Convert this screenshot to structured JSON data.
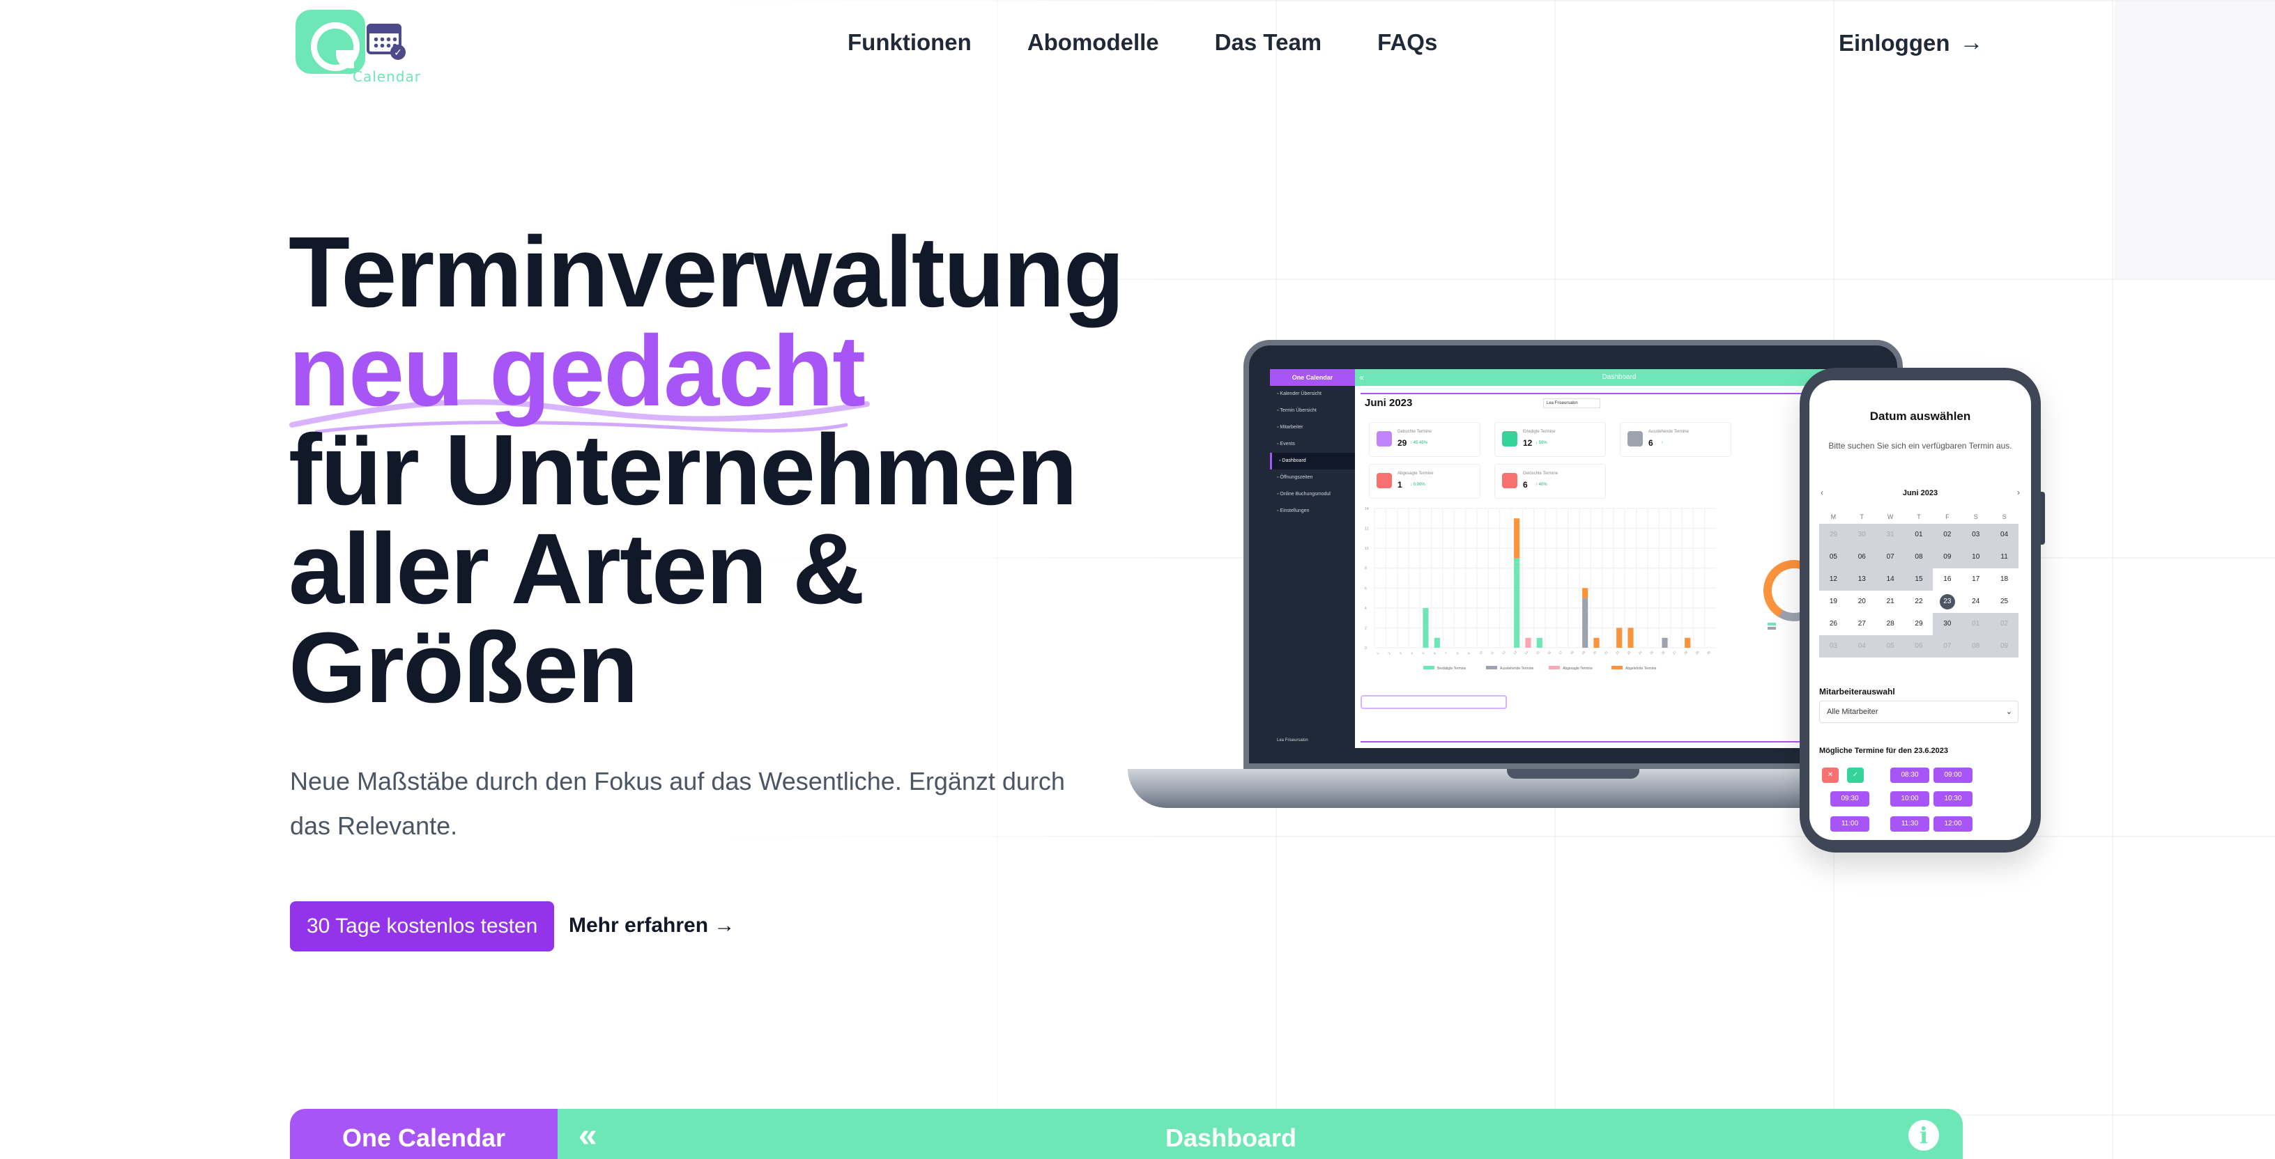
{
  "logo": {
    "alt": "One Calendar Logo",
    "text": "Calendar"
  },
  "nav": {
    "links": [
      "Funktionen",
      "Abomodelle",
      "Das Team",
      "FAQs"
    ],
    "login": "Einloggen",
    "login_arrow": "→"
  },
  "hero": {
    "title_line1": "Terminverwaltung",
    "title_accent": "neu gedacht",
    "title_line3": "für Unternehmen",
    "title_line4": "aller Arten &",
    "title_line5": "Größen",
    "subtitle": "Neue Maßstäbe durch den Fokus auf das Wesentliche. Ergänzt durch das Relevante.",
    "cta": "30 Tage kostenlos testen",
    "more": "Mehr erfahren →"
  },
  "laptop": {
    "brand": "One Calendar",
    "topbar_title": "Dashboard",
    "sidebar": [
      "Kalender Übersicht",
      "Termin Übersicht",
      "Mitarbeiter",
      "Events",
      "Dashboard",
      "Öffnungszeiten",
      "Online Buchungsmodul",
      "Einstellungen"
    ],
    "active_index": 4,
    "user": "Lea Friseursalon",
    "month": "Juni 2023",
    "dropdown": "Lea Friseursalon",
    "stats": [
      {
        "label": "Gebuchte Termine",
        "value": "29",
        "change": "↑ 45.45%",
        "color": "#c084fc"
      },
      {
        "label": "Erledigte Termine",
        "value": "12",
        "change": "↓ 50%",
        "color": "#34d399"
      },
      {
        "label": "Ausstehende Termine",
        "value": "6",
        "change": "↑",
        "color": "#9ca3af"
      },
      {
        "label": "Abgesagte Termine",
        "value": "1",
        "change": "↓ 0.00%",
        "color": "#f87171"
      },
      {
        "label": "Gelöschte Termine",
        "value": "6",
        "change": "↑ 40%",
        "color": "#f87171"
      }
    ]
  },
  "chart_data": {
    "type": "bar",
    "stacked": true,
    "categories": [
      "1",
      "2",
      "3",
      "4",
      "5",
      "6",
      "7",
      "8",
      "9",
      "10",
      "11",
      "12",
      "13",
      "14",
      "15",
      "16",
      "17",
      "18",
      "19",
      "20",
      "21",
      "22",
      "23",
      "24",
      "25",
      "26",
      "27",
      "28",
      "29",
      "30"
    ],
    "series": [
      {
        "name": "Bestätigte Termine",
        "color": "#6ee7b7",
        "values": [
          0,
          0,
          0,
          0,
          4,
          1,
          0,
          0,
          0,
          0,
          0,
          0,
          9,
          0,
          1,
          0,
          0,
          0,
          0,
          0,
          0,
          0,
          0,
          0,
          0,
          0,
          0,
          0,
          0,
          0
        ]
      },
      {
        "name": "Ausstehende Termine",
        "color": "#9ca3af",
        "values": [
          0,
          0,
          0,
          0,
          0,
          0,
          0,
          0,
          0,
          0,
          0,
          0,
          0,
          0,
          0,
          0,
          0,
          0,
          5,
          0,
          0,
          0,
          0,
          0,
          0,
          1,
          0,
          0,
          0,
          0
        ]
      },
      {
        "name": "Abgesagte Termine",
        "color": "#f9a8b4",
        "values": [
          0,
          0,
          0,
          0,
          0,
          0,
          0,
          0,
          0,
          0,
          0,
          0,
          0,
          1,
          0,
          0,
          0,
          0,
          0,
          0,
          0,
          0,
          0,
          0,
          0,
          0,
          0,
          0,
          0,
          0
        ]
      },
      {
        "name": "Abgelehnte Termine",
        "color": "#fb923c",
        "values": [
          0,
          0,
          0,
          0,
          0,
          0,
          0,
          0,
          0,
          0,
          0,
          0,
          4,
          0,
          0,
          0,
          0,
          0,
          1,
          1,
          0,
          2,
          2,
          0,
          0,
          0,
          0,
          1,
          0,
          0
        ]
      }
    ],
    "ylim": [
      0,
      14
    ],
    "legend": "bottom"
  },
  "phone": {
    "title": "Datum auswählen",
    "subtitle": "Bitte suchen Sie sich ein verfügbaren Termin aus.",
    "month": "Juni 2023",
    "weekdays": [
      "M",
      "T",
      "W",
      "T",
      "F",
      "S",
      "S"
    ],
    "days": [
      "29",
      "30",
      "31",
      "01",
      "02",
      "03",
      "04",
      "05",
      "06",
      "07",
      "08",
      "09",
      "10",
      "11",
      "12",
      "13",
      "14",
      "15",
      "16",
      "17",
      "18",
      "19",
      "20",
      "21",
      "22",
      "23",
      "24",
      "25",
      "26",
      "27",
      "28",
      "29",
      "30",
      "01",
      "02",
      "03",
      "04",
      "05",
      "06",
      "07",
      "08",
      "09"
    ],
    "selected_day": "23",
    "staff_label": "Mitarbeiterauswahl",
    "staff_value": "Alle Mitarbeiter",
    "slots_label": "Mögliche Termine für den 23.6.2023",
    "slots": [
      "08:30",
      "09:00",
      "09:30",
      "10:00",
      "10:30",
      "11:00",
      "11:30",
      "12:00"
    ]
  },
  "bottom": {
    "brand": "One Calendar",
    "title": "Dashboard",
    "info": "i"
  }
}
